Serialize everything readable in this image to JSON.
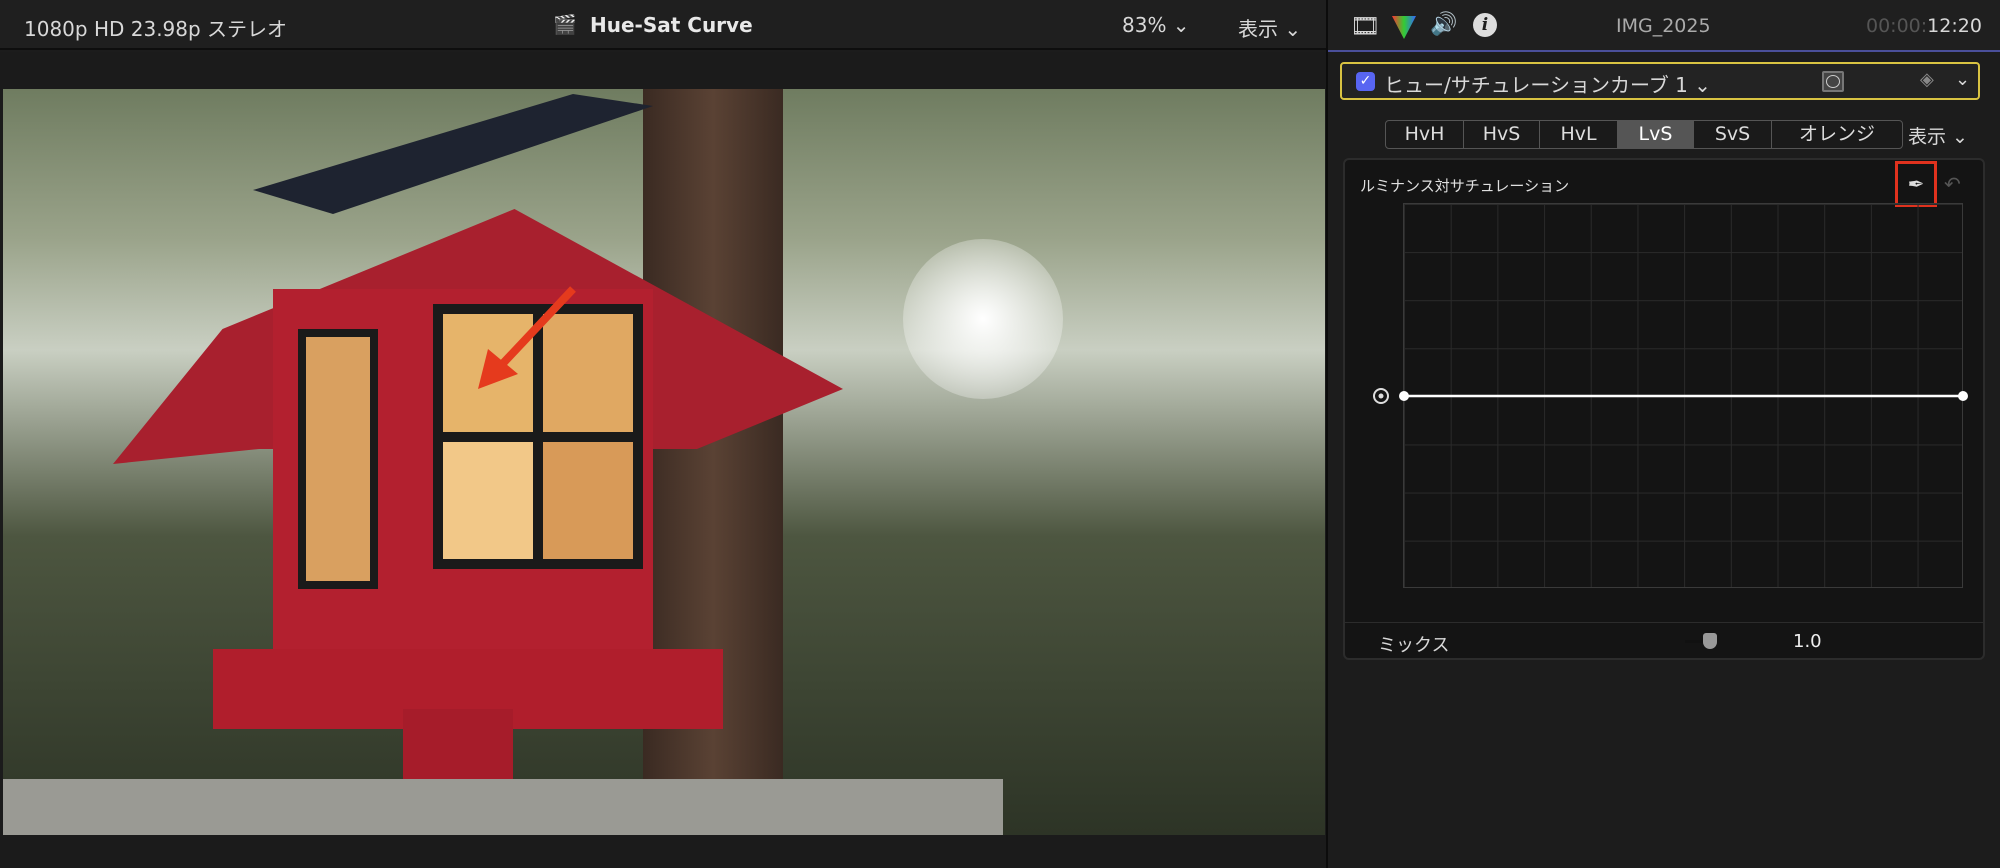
{
  "viewer": {
    "format": "1080p HD 23.98p ステレオ",
    "title": "Hue-Sat Curve",
    "zoom": "83%",
    "view": "表示"
  },
  "inspector": {
    "clip_name": "IMG_2025",
    "timecode_dim": "00:00:",
    "timecode": "12:20",
    "effect": {
      "name": "ヒュー/サチュレーションカーブ 1",
      "enabled": true
    },
    "tabs": [
      "HvH",
      "HvS",
      "HvL",
      "LvS",
      "SvS",
      "オレンジ"
    ],
    "active_tab": "LvS",
    "view": "表示",
    "graph_title": "ルミナンス対サチュレーション",
    "mix": {
      "label": "ミックス",
      "value": "1.0"
    }
  },
  "colors": {
    "accent_yellow": "#d9c342",
    "highlight_red": "#e0321e",
    "checkbox": "#5865f2"
  }
}
